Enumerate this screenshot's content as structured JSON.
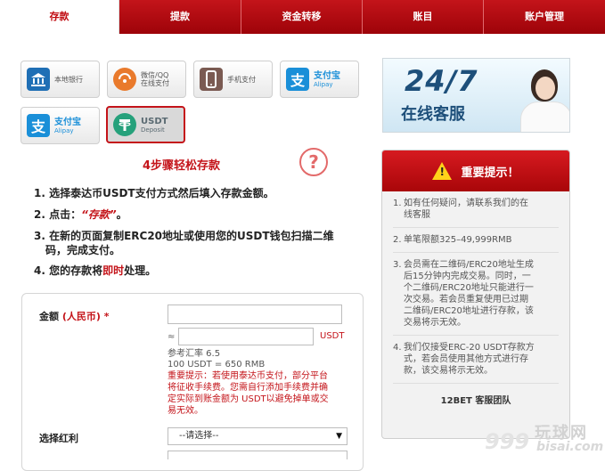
{
  "tabs": [
    {
      "label": "存款",
      "active": true
    },
    {
      "label": "提款",
      "active": false
    },
    {
      "label": "资金转移",
      "active": false
    },
    {
      "label": "账目",
      "active": false
    },
    {
      "label": "账户管理",
      "active": false
    }
  ],
  "payment_methods": [
    {
      "label": "本地银行",
      "icon": "bank-icon"
    },
    {
      "label": "微信/QQ",
      "label2": "在线支付",
      "icon": "wechat-pay-icon"
    },
    {
      "label": "手机支付",
      "icon": "mobile-icon"
    },
    {
      "label": "支付宝",
      "sub": "Alipay",
      "icon": "alipay-icon"
    },
    {
      "label": "支付宝",
      "sub": "Alipay",
      "icon": "alipay-icon"
    },
    {
      "label": "USDT",
      "sub": "Deposit",
      "icon": "tether-icon",
      "selected": true
    }
  ],
  "steps": {
    "title": "4步骤轻松存款",
    "s1": "1. 选择泰达币USDT支付方式然后填入存款金额。",
    "s2_prefix": "2. 点击：",
    "s2_highlight": "“存款”",
    "s2_suffix": "。",
    "s3_line1": "3. 在新的页面复制ERC20地址或使用您的USDT钱包扫描二维",
    "s3_line2": "码，完成支付。",
    "s4_prefix": "4. 您的存款将",
    "s4_highlight": "即时",
    "s4_suffix": "处理。"
  },
  "form": {
    "amount_label": "金额",
    "amount_unit": "(人民币) *",
    "approx": "≈",
    "usdt_unit": "USDT",
    "rate_label": "参考汇率 6.5",
    "rate_example": "100 USDT = 650 RMB",
    "warning_l1": "重要提示：若使用泰达币支付，部分平台",
    "warning_l2": "将征收手续费。您需自行添加手续费并确",
    "warning_l3": "定实际到账金额为 USDT以避免掉单或交",
    "warning_l4": "易无效。",
    "bonus_label": "选择红利",
    "bonus_value": "--请选择--"
  },
  "banner": {
    "big": "24/7",
    "small": "在线客服"
  },
  "notice": {
    "title": "重要提示！",
    "items": [
      {
        "n": "1.",
        "l1": "如有任何疑问，请联系我们的在",
        "l2": "线客服",
        "l3": "",
        "l4": "",
        "l5": ""
      },
      {
        "n": "2.",
        "l1": "单笔限额325–49,999RMB",
        "l2": "",
        "l3": "",
        "l4": "",
        "l5": ""
      },
      {
        "n": "3.",
        "l1": "会员需在二维码/ERC20地址生成",
        "l2": "后15分钟内完成交易。同时，一",
        "l3": "个二维码/ERC20地址只能进行一",
        "l4": "次交易。若会员重复使用已过期",
        "l5": "二维码/ERC20地址进行存款，该"
      },
      {
        "n": "",
        "l1": "交易将示无效。",
        "l2": "",
        "l3": "",
        "l4": "",
        "l5": ""
      },
      {
        "n": "4.",
        "l1": "我们仅接受ERC-20 USDT存款方",
        "l2": "式，若会员使用其他方式进行存",
        "l3": "款，该交易将示无效。",
        "l4": "",
        "l5": ""
      }
    ],
    "footer": "12BET 客服团队"
  },
  "watermark": {
    "num": "999",
    "big": "玩球网",
    "small": "bisai.com"
  },
  "colors": {
    "brand_red": "#c4141a",
    "tab_bar": "#b5080d",
    "notice_bg": "#f2f2f2",
    "banner_text": "#1d4f7a"
  }
}
